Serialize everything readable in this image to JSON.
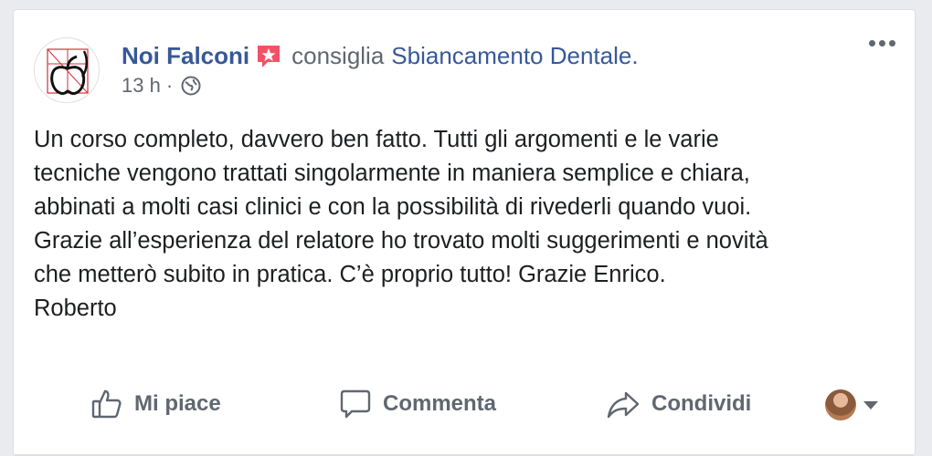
{
  "post": {
    "author": "Noi Falconi",
    "verb": "consiglia",
    "page": "Sbiancamento Dentale.",
    "time": "13 h",
    "separator": "·",
    "body_lines": [
      "Un corso completo, davvero ben fatto. Tutti gli argomenti e le varie",
      "tecniche vengono trattati singolarmente in maniera semplice e chiara,",
      "abbinati a molti casi clinici e con la possibilità di rivederli quando vuoi.",
      "Grazie all’esperienza del relatore ho trovato molti suggerimenti e novità",
      "che metterò subito in pratica. C’è proprio tutto! Grazie Enrico.",
      "Roberto"
    ]
  },
  "actions": {
    "like": "Mi piace",
    "comment": "Commenta",
    "share": "Condividi"
  },
  "icons": {
    "avatar": "apple-logo-avatar",
    "badge": "recommendation-star-icon",
    "audience": "globe-icon",
    "more": "more-options-icon",
    "like": "thumbs-up-icon",
    "comment": "comment-bubble-icon",
    "share": "share-arrow-icon"
  },
  "colors": {
    "link": "#385898",
    "meta": "#616770",
    "text": "#1c1e21",
    "badge": "#f25268"
  }
}
